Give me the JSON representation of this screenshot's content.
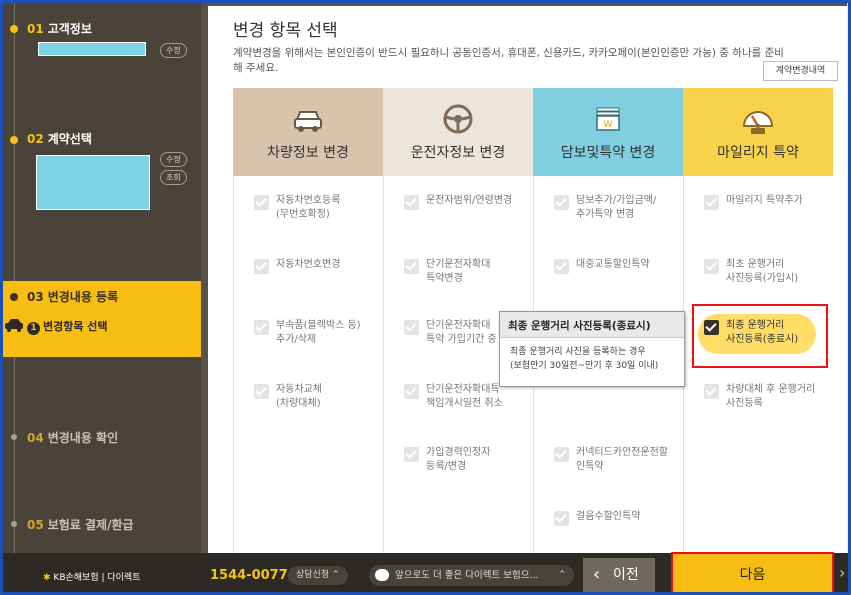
{
  "sidebar": {
    "steps": [
      {
        "num": "01",
        "title": "고객정보",
        "buttons": [
          "수정"
        ]
      },
      {
        "num": "02",
        "title": "계약선택",
        "buttons": [
          "수정",
          "조회"
        ]
      },
      {
        "num": "03",
        "title": "변경내용 등록",
        "sub_num": "1",
        "sub_label": "변경항목 선택"
      },
      {
        "num": "04",
        "title": "변경내용 확인"
      },
      {
        "num": "05",
        "title": "보험료 결제/환급"
      }
    ]
  },
  "main": {
    "title": "변경 항목 선택",
    "description": "계약변경을 위해서는 본인인증이 반드시 필요하니 공동인증서, 휴대폰, 신용카드, 카카오페이(본인인증만 가능) 중 하나를 준비해 주세요.",
    "history_button": "계약변경내역",
    "columns": [
      {
        "label": "차량정보 변경",
        "bg": "#d8c3ad",
        "icon": "car-icon",
        "items": [
          "자동차번호등록\n(무번호확정)",
          "자동차번호변경",
          "부속품(블랙박스 등)\n추가/삭제",
          "자동차교체\n(차량대체)"
        ]
      },
      {
        "label": "운전자정보 변경",
        "bg": "#ece5da",
        "icon": "steering-wheel-icon",
        "items": [
          "운전자범위/연령변경",
          "단기운전자확대\n특약변경",
          "단기운전자확대\n특약 가입기간 중",
          "단기운전자확대특\n책임개시일전 취소",
          "가입경력인정자\n등록/변경"
        ]
      },
      {
        "label": "담보및특약 변경",
        "bg": "#7fcfe0",
        "icon": "coin-stack-icon",
        "items": [
          "담보추가/가입금액/\n추가특약 변경",
          "대중교통할인특약",
          "",
          "",
          "커넥티드카안전운전할\n인특약",
          "걸음수할인특약"
        ]
      },
      {
        "label": "마일리지 특약",
        "bg": "#f9d24c",
        "icon": "speedometer-icon",
        "items": [
          "마일리지 특약추가",
          "최초 운행거리\n사진등록(가입시)",
          "최종 운행거리\n사진등록(종료시)",
          "차량대체 후 운행거리\n사진등록"
        ]
      }
    ],
    "tooltip": {
      "title": "최종 운행거리 사진등록(종료시)",
      "body": "최종 운행거리 사진을 등록하는 경우\n(보험만기 30일전~만기 후 30일 이내)"
    }
  },
  "footer": {
    "brand": "KB손해보험 | 다이렉트",
    "phone": "1544-0077",
    "consult": "상담신청",
    "chat": "앞으로도 더 좋은 다이렉트 보험으...",
    "prev": "이전",
    "next": "다음"
  }
}
